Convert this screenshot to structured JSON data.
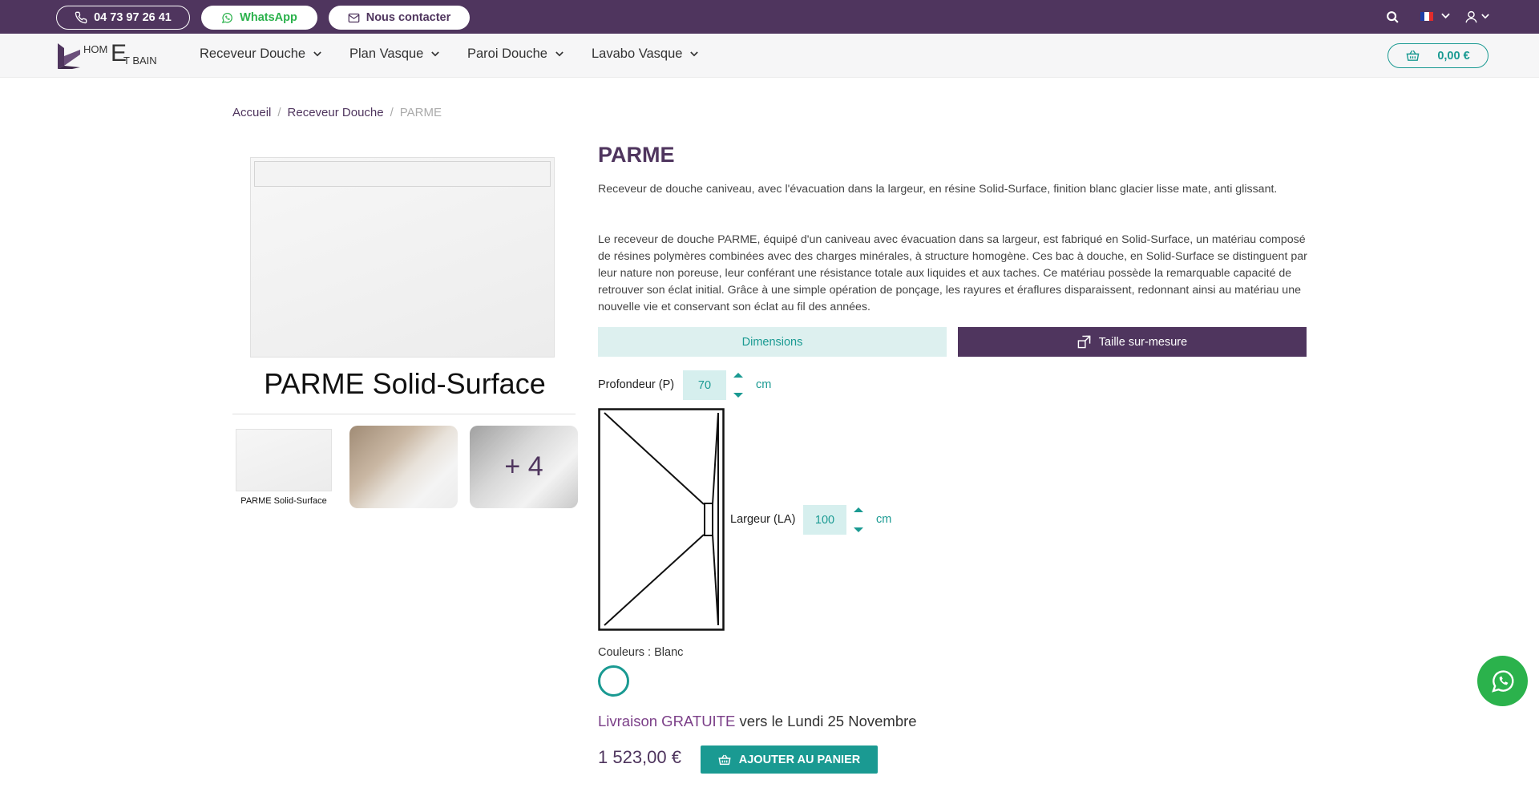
{
  "topbar": {
    "phone": "04 73 97 26 41",
    "whatsapp": "WhatsApp",
    "contact": "Nous contacter",
    "icons": [
      "search-icon",
      "flag-fr-icon",
      "chevron-down-icon",
      "user-icon"
    ]
  },
  "nav": {
    "logo": {
      "home": "HOM",
      "e": "E",
      "bain": "T BAIN"
    },
    "items": [
      {
        "label": "Receveur Douche"
      },
      {
        "label": "Plan Vasque"
      },
      {
        "label": "Paroi Douche"
      },
      {
        "label": "Lavabo Vasque"
      }
    ],
    "cart_total": "0,00 €"
  },
  "breadcrumb": {
    "home": "Accueil",
    "category": "Receveur Douche",
    "current": "PARME",
    "separator": "/"
  },
  "gallery": {
    "main_caption": "PARME Solid-Surface",
    "thumb1_caption": "PARME Solid-Surface",
    "more_count": "+ 4"
  },
  "product": {
    "title": "PARME",
    "description_short": "Receveur de douche caniveau, avec l'évacuation dans la largeur, en résine Solid-Surface, finition blanc glacier lisse mate, anti glissant.",
    "description_long": "Le receveur de douche PARME, équipé d'un caniveau avec évacuation dans sa largeur, est fabriqué en Solid-Surface, un matériau composé de résines polymères combinées avec des charges minérales, à structure homogène. Ces bac à douche, en Solid-Surface se distinguent par leur nature non poreuse, leur conférant une résistance totale aux liquides et aux taches. Ce matériau possède la remarquable capacité de retrouver son éclat initial. Grâce à une simple opération de ponçage, les rayures et éraflures disparaissent, redonnant ainsi au matériau une nouvelle vie et conservant son éclat au fil des années.",
    "btn_dimensions": "Dimensions",
    "btn_custom": "Taille sur-mesure",
    "depth_label": "Profondeur (P)",
    "depth_value": "70",
    "width_label": "Largeur (LA)",
    "width_value": "100",
    "unit": "cm",
    "colors_label": "Couleurs : Blanc",
    "delivery_highlight": "Livraison GRATUITE",
    "delivery_rest": " vers le Lundi 25 Novembre",
    "price": "1 523,00 €",
    "add_to_cart": "AJOUTER AU PANIER"
  },
  "colors": {
    "primary_purple": "#4f355e",
    "accent_teal": "#1a9a92",
    "whatsapp_green": "#2bb24c"
  }
}
